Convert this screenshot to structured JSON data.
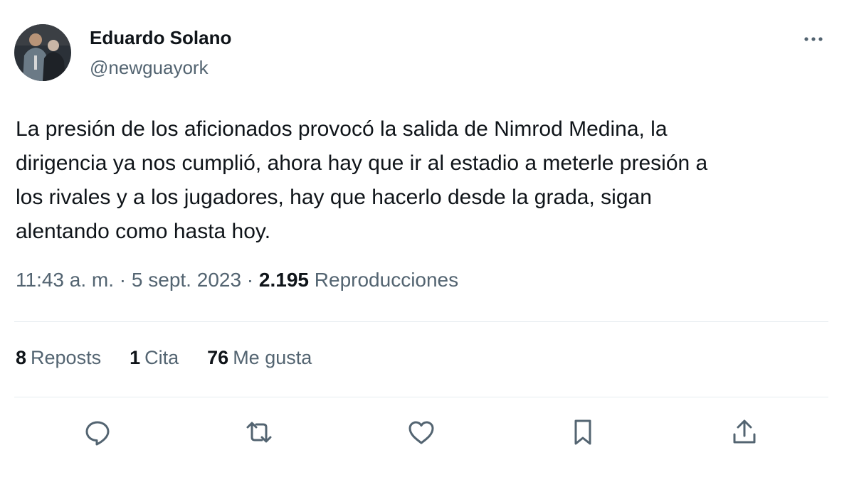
{
  "author": {
    "name": "Eduardo Solano",
    "handle": "@newguayork"
  },
  "tweet": {
    "text": "La presión de los aficionados provocó la salida de Nimrod Medina, la\ndirigencia ya nos cumplió, ahora hay que ir al estadio a meterle presión a\nlos rivales y a los jugadores, hay que hacerlo desde la grada, sigan\nalentando como hasta hoy.",
    "time": "11:43 a. m.",
    "separator": " · ",
    "date": "5 sept. 2023",
    "views_count": "2.195",
    "views_label": "Reproducciones"
  },
  "stats": {
    "reposts_count": "8",
    "reposts_label": "Reposts",
    "quotes_count": "1",
    "quotes_label": "Cita",
    "likes_count": "76",
    "likes_label": "Me gusta"
  },
  "icons": {
    "more": "more-horizontal-icon",
    "reply": "reply-bubble-icon",
    "repost": "repost-arrows-icon",
    "like": "heart-icon",
    "bookmark": "bookmark-icon",
    "share": "share-upload-icon"
  },
  "colors": {
    "text_primary": "#0f1419",
    "text_secondary": "#536471",
    "divider": "#e6ecf0"
  }
}
